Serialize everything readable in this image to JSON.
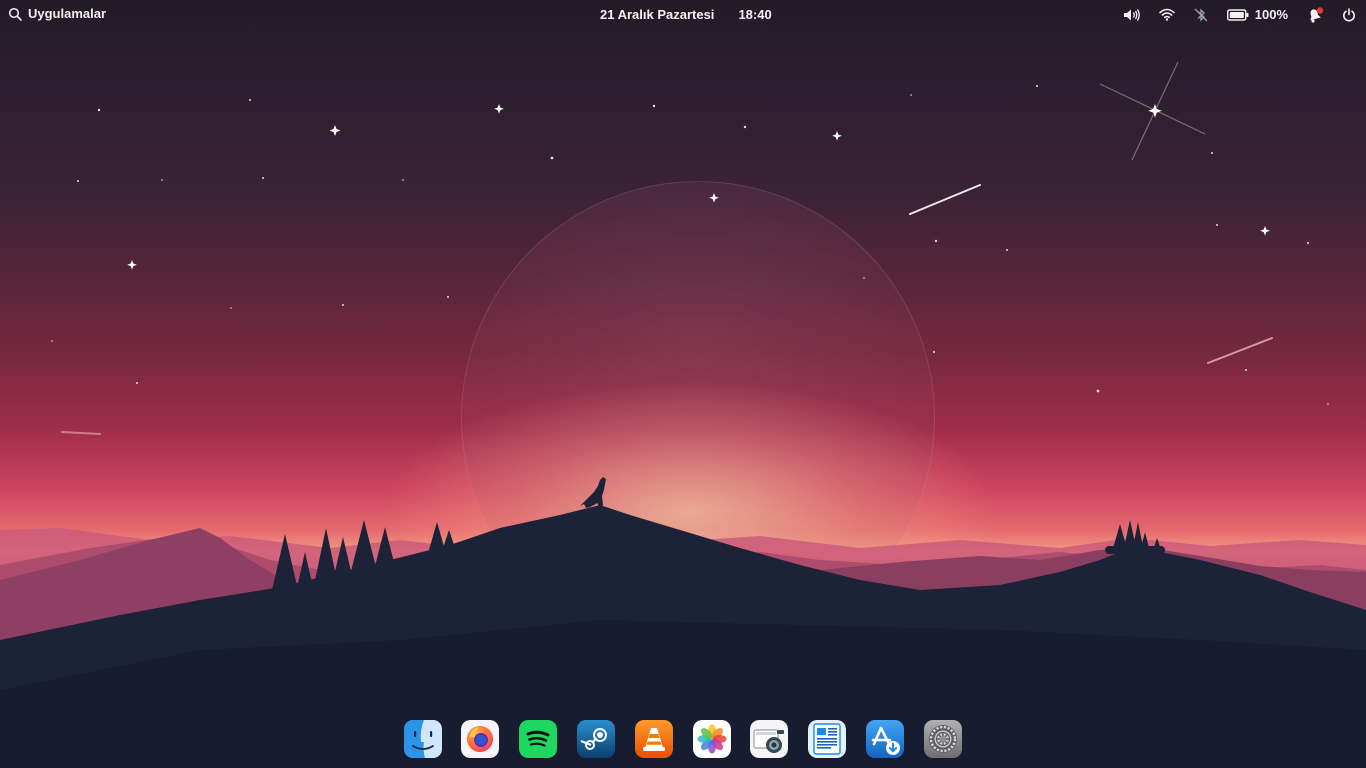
{
  "topbar": {
    "apps_label": "Uygulamalar",
    "date": "21 Aralık Pazartesi",
    "time": "18:40",
    "battery_level": "100%",
    "tray_icons": [
      "volume-icon",
      "wifi-icon",
      "bluetooth-off-icon",
      "battery-icon",
      "notification-bell-icon",
      "power-icon"
    ],
    "notification_dot_color": "#e53935"
  },
  "wallpaper": {
    "theme": "wolf howling at moon over mountains",
    "colors": {
      "sky_top": "#231a27",
      "sky_mid": "#a02d4c",
      "horizon": "#f09e86",
      "foreground": "#1b2338"
    }
  },
  "dock": {
    "apps": [
      {
        "name": "Finder",
        "icon": "finder-icon",
        "color": "#1e88e5"
      },
      {
        "name": "Firefox",
        "icon": "firefox-icon",
        "color": "#ff7139"
      },
      {
        "name": "Spotify",
        "icon": "spotify-icon",
        "color": "#1ed760"
      },
      {
        "name": "Steam",
        "icon": "steam-icon",
        "color": "#1b6fa8"
      },
      {
        "name": "VLC",
        "icon": "vlc-icon",
        "color": "#f57c00"
      },
      {
        "name": "Photos",
        "icon": "photos-icon",
        "color": "#ffffff"
      },
      {
        "name": "Screenshot",
        "icon": "screenshot-icon",
        "color": "#eeeeee"
      },
      {
        "name": "Document Viewer",
        "icon": "document-viewer-icon",
        "color": "#e3f2fd"
      },
      {
        "name": "App Store",
        "icon": "app-store-icon",
        "color": "#1e88e5"
      },
      {
        "name": "System Preferences",
        "icon": "system-preferences-icon",
        "color": "#8e8e93"
      }
    ]
  }
}
